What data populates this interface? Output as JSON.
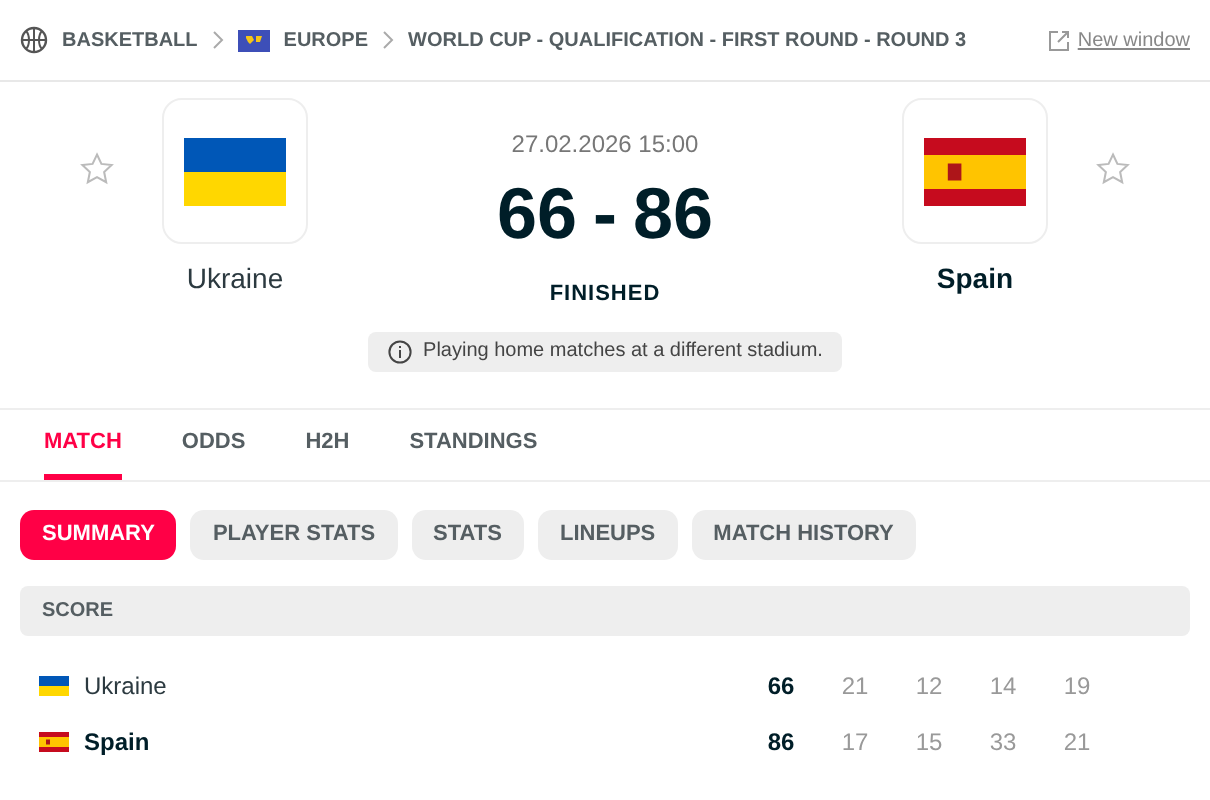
{
  "breadcrumb": [
    {
      "kind": "sport",
      "label": "BASKETBALL"
    },
    {
      "kind": "region",
      "label": "EUROPE"
    },
    {
      "kind": "league",
      "label": "WORLD CUP - QUALIFICATION - FIRST ROUND - ROUND 3"
    }
  ],
  "new_window": "New window",
  "match": {
    "datetime": "27.02.2026 15:00",
    "home_score": "66",
    "separator": "-",
    "away_score": "86",
    "status": "FINISHED",
    "note": "Playing home matches at a different stadium."
  },
  "teams": [
    {
      "name": "Ukraine",
      "kind": "ua",
      "winner": false
    },
    {
      "name": "Spain",
      "kind": "es",
      "winner": true
    }
  ],
  "tabs": [
    {
      "label": "MATCH",
      "selected": true
    },
    {
      "label": "ODDS",
      "selected": false
    },
    {
      "label": "H2H",
      "selected": false
    },
    {
      "label": "STANDINGS",
      "selected": false
    }
  ],
  "subtabs": [
    {
      "label": "SUMMARY",
      "selected": true
    },
    {
      "label": "PLAYER STATS",
      "selected": false
    },
    {
      "label": "STATS",
      "selected": false
    },
    {
      "label": "LINEUPS",
      "selected": false
    },
    {
      "label": "MATCH HISTORY",
      "selected": false
    }
  ],
  "score_table": {
    "header": "SCORE",
    "rows": [
      {
        "team": "Ukraine",
        "kind": "ua",
        "winner": false,
        "total": "66",
        "periods": [
          "21",
          "12",
          "14",
          "19"
        ]
      },
      {
        "team": "Spain",
        "kind": "es",
        "winner": true,
        "total": "86",
        "periods": [
          "17",
          "15",
          "33",
          "21"
        ]
      }
    ]
  }
}
